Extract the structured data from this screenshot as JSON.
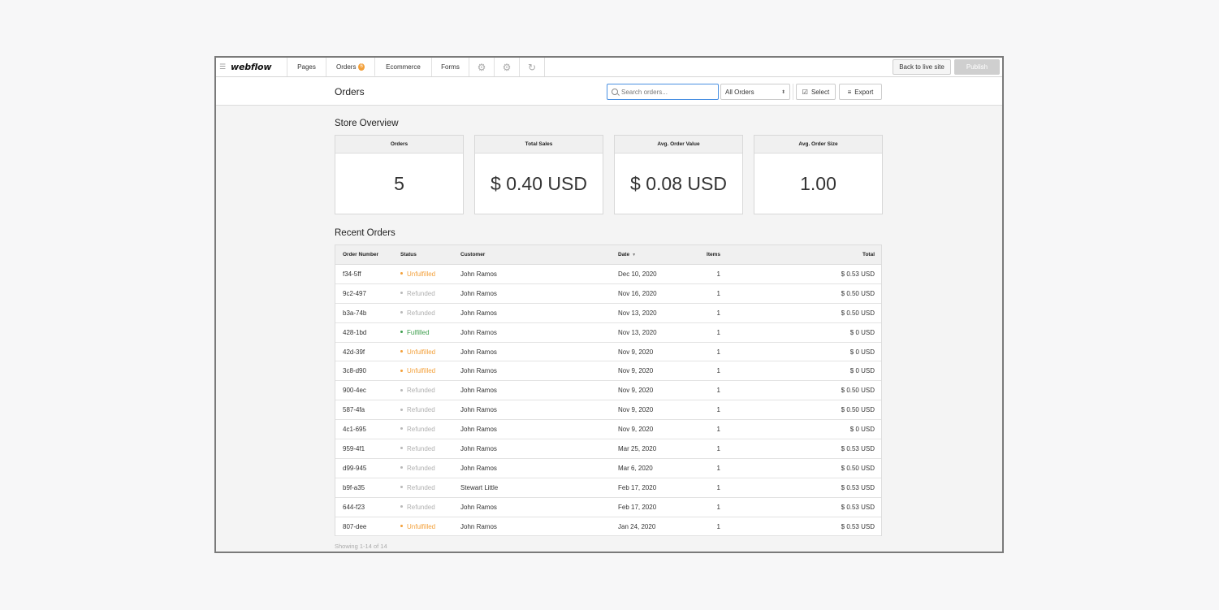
{
  "topbar": {
    "logo": "webflow",
    "tabs": [
      {
        "label": "Pages"
      },
      {
        "label": "Orders",
        "badge": "6"
      },
      {
        "label": "Ecommerce"
      },
      {
        "label": "Forms"
      }
    ],
    "back_label": "Back to live site",
    "publish_label": "Publish"
  },
  "subheader": {
    "title": "Orders",
    "search_placeholder": "Search orders...",
    "filter_value": "All Orders",
    "select_label": "Select",
    "export_label": "Export"
  },
  "overview": {
    "title": "Store Overview",
    "cards": [
      {
        "label": "Orders",
        "value": "5"
      },
      {
        "label": "Total Sales",
        "value": "$ 0.40 USD"
      },
      {
        "label": "Avg. Order Value",
        "value": "$ 0.08 USD"
      },
      {
        "label": "Avg. Order Size",
        "value": "1.00"
      }
    ]
  },
  "recent": {
    "title": "Recent Orders",
    "columns": {
      "number": "Order Number",
      "status": "Status",
      "customer": "Customer",
      "date": "Date",
      "items": "Items",
      "total": "Total"
    },
    "rows": [
      {
        "number": "f34-5ff",
        "status": "Unfulfilled",
        "customer": "John Ramos",
        "date": "Dec 10, 2020",
        "items": "1",
        "total": "$ 0.53 USD"
      },
      {
        "number": "9c2-497",
        "status": "Refunded",
        "customer": "John Ramos",
        "date": "Nov 16, 2020",
        "items": "1",
        "total": "$ 0.50 USD"
      },
      {
        "number": "b3a-74b",
        "status": "Refunded",
        "customer": "John Ramos",
        "date": "Nov 13, 2020",
        "items": "1",
        "total": "$ 0.50 USD"
      },
      {
        "number": "428-1bd",
        "status": "Fulfilled",
        "customer": "John Ramos",
        "date": "Nov 13, 2020",
        "items": "1",
        "total": "$ 0 USD"
      },
      {
        "number": "42d-39f",
        "status": "Unfulfilled",
        "customer": "John Ramos",
        "date": "Nov 9, 2020",
        "items": "1",
        "total": "$ 0 USD"
      },
      {
        "number": "3c8-d90",
        "status": "Unfulfilled",
        "customer": "John Ramos",
        "date": "Nov 9, 2020",
        "items": "1",
        "total": "$ 0 USD"
      },
      {
        "number": "900-4ec",
        "status": "Refunded",
        "customer": "John Ramos",
        "date": "Nov 9, 2020",
        "items": "1",
        "total": "$ 0.50 USD"
      },
      {
        "number": "587-4fa",
        "status": "Refunded",
        "customer": "John Ramos",
        "date": "Nov 9, 2020",
        "items": "1",
        "total": "$ 0.50 USD"
      },
      {
        "number": "4c1-695",
        "status": "Refunded",
        "customer": "John Ramos",
        "date": "Nov 9, 2020",
        "items": "1",
        "total": "$ 0 USD"
      },
      {
        "number": "959-4f1",
        "status": "Refunded",
        "customer": "John Ramos",
        "date": "Mar 25, 2020",
        "items": "1",
        "total": "$ 0.53 USD"
      },
      {
        "number": "d99-945",
        "status": "Refunded",
        "customer": "John Ramos",
        "date": "Mar 6, 2020",
        "items": "1",
        "total": "$ 0.50 USD"
      },
      {
        "number": "b9f-a35",
        "status": "Refunded",
        "customer": "Stewart Little",
        "date": "Feb 17, 2020",
        "items": "1",
        "total": "$ 0.53 USD"
      },
      {
        "number": "644-f23",
        "status": "Refunded",
        "customer": "John Ramos",
        "date": "Feb 17, 2020",
        "items": "1",
        "total": "$ 0.53 USD"
      },
      {
        "number": "807-dee",
        "status": "Unfulfilled",
        "customer": "John Ramos",
        "date": "Jan 24, 2020",
        "items": "1",
        "total": "$ 0.53 USD"
      }
    ],
    "showing": "Showing 1-14 of 14"
  },
  "colors": {
    "accent": "#4a90e2",
    "unfulfilled": "#f3a03a",
    "refunded": "#b0b0b0",
    "fulfilled": "#3f9f4f"
  }
}
